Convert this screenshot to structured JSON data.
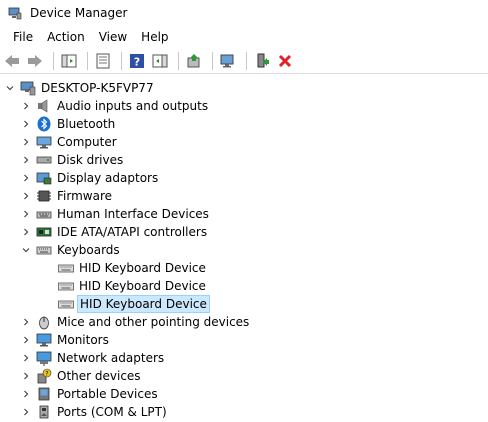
{
  "window": {
    "title": "Device Manager"
  },
  "menu": [
    "File",
    "Action",
    "View",
    "Help"
  ],
  "toolbar": {
    "buttons": [
      "back-icon",
      "forward-icon",
      "show-hide-console-tree-icon",
      "properties-icon",
      "help-icon",
      "show-action-pane-icon",
      "update-driver-icon",
      "scan-hardware-icon",
      "enable-device-icon",
      "uninstall-device-icon"
    ]
  },
  "tree": {
    "root": "DESKTOP-K5FVP77",
    "categories": [
      {
        "label": "Audio inputs and outputs",
        "icon": "speaker-icon"
      },
      {
        "label": "Bluetooth",
        "icon": "bluetooth-icon"
      },
      {
        "label": "Computer",
        "icon": "computer-icon"
      },
      {
        "label": "Disk drives",
        "icon": "disk-drive-icon"
      },
      {
        "label": "Display adaptors",
        "icon": "display-adapter-icon"
      },
      {
        "label": "Firmware",
        "icon": "firmware-icon"
      },
      {
        "label": "Human Interface Devices",
        "icon": "hid-icon"
      },
      {
        "label": "IDE ATA/ATAPI controllers",
        "icon": "ide-controller-icon"
      },
      {
        "label": "Keyboards",
        "icon": "keyboard-icon",
        "expanded": true,
        "children": [
          {
            "label": "HID Keyboard Device"
          },
          {
            "label": "HID Keyboard Device"
          },
          {
            "label": "HID Keyboard Device",
            "selected": true
          }
        ]
      },
      {
        "label": "Mice and other pointing devices",
        "icon": "mouse-icon"
      },
      {
        "label": "Monitors",
        "icon": "monitor-icon"
      },
      {
        "label": "Network adapters",
        "icon": "network-adapter-icon"
      },
      {
        "label": "Other devices",
        "icon": "other-devices-icon"
      },
      {
        "label": "Portable Devices",
        "icon": "portable-device-icon"
      },
      {
        "label": "Ports (COM & LPT)",
        "icon": "port-icon"
      }
    ]
  },
  "colors": {
    "selection_bg": "#cce8ff",
    "selection_border": "#99d1ff",
    "accent": "#0078d4"
  }
}
